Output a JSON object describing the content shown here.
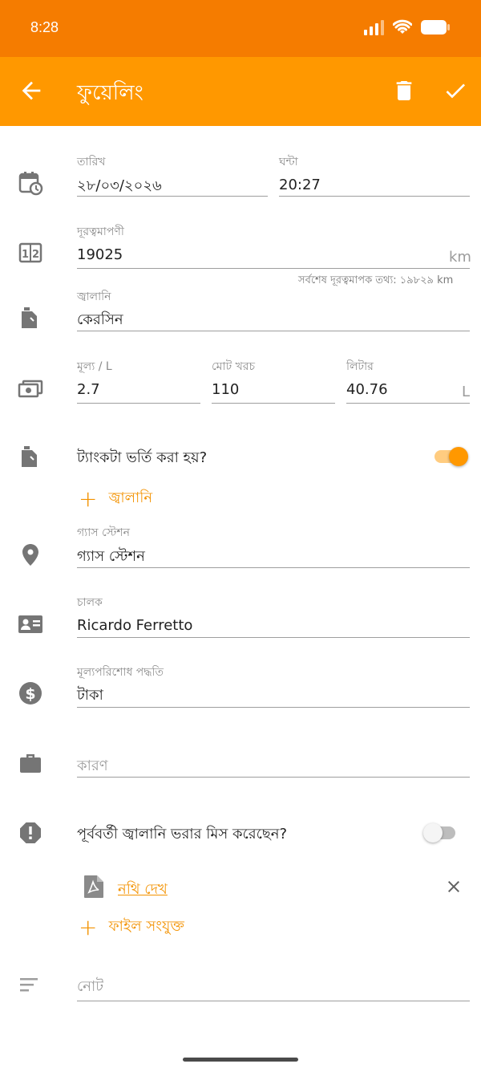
{
  "status_bar": {
    "time": "8:28"
  },
  "app_bar": {
    "title": "ফুয়েলিং",
    "colors": {
      "status": "#F57C00",
      "toolbar": "#FF9800",
      "accent": "#F39200"
    }
  },
  "date": {
    "label": "তারিখ",
    "value": "২৮/০৩/২০২৬"
  },
  "time": {
    "label": "ঘন্টা",
    "value": "20:27"
  },
  "odometer": {
    "label": "দূরত্বমাপণী",
    "value": "19025",
    "unit": "km",
    "hint": "সর্বশেষ দূরত্বমাপক তথ্য: ১৯৮২৯ km"
  },
  "fuel": {
    "label": "জ্বালানি",
    "value": "কেরসিন"
  },
  "price": {
    "label": "মূল্য / L",
    "value": "2.7"
  },
  "total_cost": {
    "label": "মোট খরচ",
    "value": "110"
  },
  "liters": {
    "label": "লিটার",
    "value": "40.76",
    "unit": "L"
  },
  "tank_full": {
    "label": "ট্যাংকটা ভর্তি করা হয়?",
    "on": true
  },
  "add_fuel": {
    "label": "জ্বালানি"
  },
  "gas_station": {
    "label": "গ্যাস স্টেশন",
    "value": "গ্যাস স্টেশন"
  },
  "driver": {
    "label": "চালক",
    "value": "Ricardo Ferretto"
  },
  "payment": {
    "label": "মূল্যপরিশোধ পদ্ধতি",
    "value": "টাকা"
  },
  "reason": {
    "placeholder": "কারণ"
  },
  "missed_fill": {
    "label": "পূর্ববর্তী জ্বালানি ভরার মিস করেছেন?",
    "on": false
  },
  "attachment": {
    "link": "নথি দেখ"
  },
  "attach_file": {
    "label": "ফাইল সংযুক্ত"
  },
  "note": {
    "placeholder": "নোট"
  }
}
